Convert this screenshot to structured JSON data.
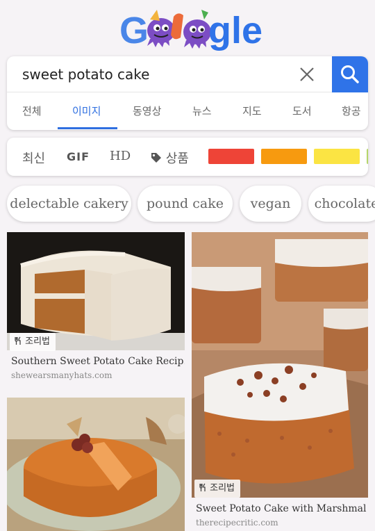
{
  "logo": {
    "alt": "Google",
    "letters_right": "gle"
  },
  "search": {
    "query": "sweet potato cake"
  },
  "tabs": [
    {
      "label": "전체"
    },
    {
      "label": "이미지",
      "active": true
    },
    {
      "label": "동영상"
    },
    {
      "label": "뉴스"
    },
    {
      "label": "지도"
    },
    {
      "label": "도서"
    },
    {
      "label": "항공"
    }
  ],
  "filters": {
    "latest": "최신",
    "gif": "GIF",
    "hd": "HD",
    "product": "상품",
    "colors": [
      "#ee4437",
      "#f79a0f",
      "#fbe443"
    ]
  },
  "suggestions": [
    {
      "label": "delectable cakery"
    },
    {
      "label": "pound cake"
    },
    {
      "label": "vegan"
    },
    {
      "label": "chocolate"
    }
  ],
  "results": [
    {
      "badge": "조리법",
      "title": "Southern Sweet Potato Cake Recip...",
      "source": "shewearsmanyhats.com"
    },
    {
      "badge": "",
      "title": "",
      "source": ""
    },
    {
      "badge": "조리법",
      "title": "Sweet Potato Cake with Marshmal...",
      "source": "therecipecritic.com"
    }
  ],
  "colors": {
    "accent": "#2f73e8",
    "tab_active": "#2f6fe0"
  }
}
